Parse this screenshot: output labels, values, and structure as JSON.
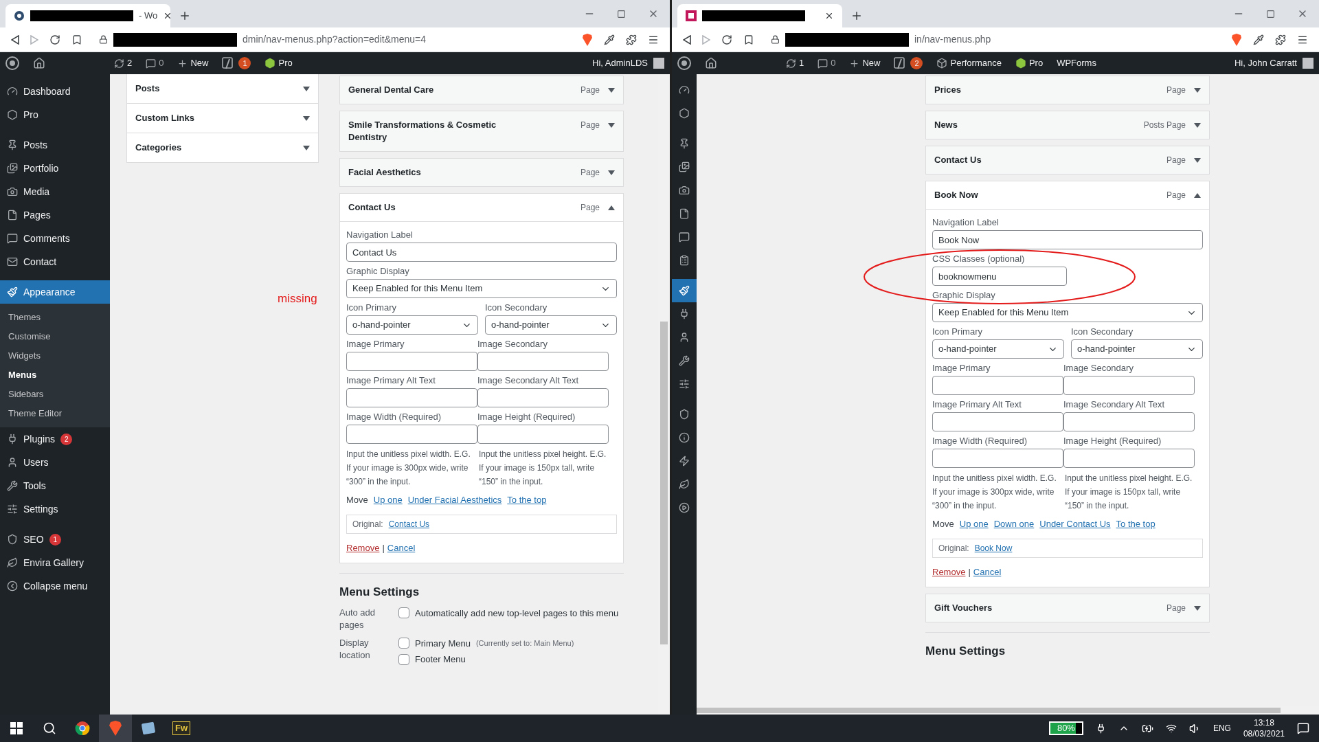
{
  "windows": [
    {
      "tab": {
        "title": "- Wo"
      },
      "url": "dmin/nav-menus.php?action=edit&menu=4",
      "admin_bar": {
        "updates": "2",
        "comments": "0",
        "new": "New",
        "badge": "1",
        "links": [
          {
            "kind": "pro",
            "label": "Pro"
          }
        ],
        "greeting": "Hi, AdminLDS"
      },
      "sidebar": {
        "kind": "full",
        "groups": [
          [
            {
              "label": "Dashboard",
              "selected": false
            },
            {
              "label": "Pro",
              "selected": false
            }
          ],
          [
            {
              "label": "Posts",
              "selected": false
            },
            {
              "label": "Portfolio",
              "selected": false
            },
            {
              "label": "Media",
              "selected": false
            },
            {
              "label": "Pages",
              "selected": false
            },
            {
              "label": "Comments",
              "selected": false
            },
            {
              "label": "Contact",
              "selected": false
            }
          ],
          [
            {
              "label": "Appearance",
              "selected": true,
              "children": [
                {
                  "label": "Themes",
                  "selected": false
                },
                {
                  "label": "Customise",
                  "selected": false
                },
                {
                  "label": "Widgets",
                  "selected": false
                },
                {
                  "label": "Menus",
                  "selected": true
                },
                {
                  "label": "Sidebars",
                  "selected": false
                },
                {
                  "label": "Theme Editor",
                  "selected": false
                }
              ]
            },
            {
              "label": "Plugins",
              "badge": "2",
              "selected": false
            },
            {
              "label": "Users",
              "selected": false
            },
            {
              "label": "Tools",
              "selected": false
            },
            {
              "label": "Settings",
              "selected": false
            }
          ],
          [
            {
              "label": "SEO",
              "badge": "1",
              "selected": false
            },
            {
              "label": "Envira Gallery",
              "selected": false
            },
            {
              "label": "Collapse menu",
              "selected": false
            }
          ]
        ]
      },
      "accordion": [
        {
          "title": "Posts",
          "expanded": false
        },
        {
          "title": "Custom Links",
          "expanded": false
        },
        {
          "title": "Categories",
          "expanded": false
        }
      ],
      "annotation": "missing",
      "menu_items": [
        {
          "title": "General Dental Care",
          "type": "Page",
          "expanded": false
        },
        {
          "title": "Smile Transformations & Cosmetic Dentistry",
          "type": "Page",
          "expanded": false
        },
        {
          "title": "Facial Aesthetics",
          "type": "Page",
          "expanded": false
        },
        {
          "title": "Contact Us",
          "type": "Page",
          "expanded": true,
          "settings": {
            "navigation_label": {
              "label": "Navigation Label",
              "value": "Contact Us"
            },
            "graphic_display": {
              "label": "Graphic Display",
              "value": "Keep Enabled for this Menu Item"
            },
            "icons": [
              {
                "label": "Icon Primary",
                "value": "o-hand-pointer"
              },
              {
                "label": "Icon Secondary",
                "value": "o-hand-pointer"
              }
            ],
            "image_fields": [
              [
                "Image Primary",
                "Image Secondary"
              ],
              [
                "Image Primary Alt Text",
                "Image Secondary Alt Text"
              ],
              [
                "Image Width (Required)",
                "Image Height (Required)"
              ]
            ],
            "help": [
              "Input the unitless pixel width. E.G. If your image is 300px wide, write “300” in the input.",
              "Input the unitless pixel height. E.G. If your image is 150px tall, write “150” in the input."
            ],
            "move": {
              "label": "Move",
              "links": [
                "Up one",
                "Under Facial Aesthetics",
                "To the top"
              ]
            },
            "original": {
              "label": "Original:",
              "link": "Contact Us"
            },
            "actions": {
              "remove": "Remove",
              "separator": "|",
              "cancel": "Cancel"
            }
          }
        }
      ],
      "menu_settings": {
        "title": "Menu Settings",
        "rows": [
          {
            "label": "Auto add pages",
            "options": [
              {
                "label": "Automatically add new top-level pages to this menu",
                "checked": false
              }
            ]
          },
          {
            "label": "Display location",
            "options": [
              {
                "label": "Primary Menu",
                "note": "(Currently set to: Main Menu)",
                "checked": false
              },
              {
                "label": "Footer Menu",
                "checked": false
              }
            ]
          }
        ]
      }
    },
    {
      "url": "in/nav-menus.php",
      "admin_bar": {
        "updates": "1",
        "comments": "0",
        "new": "New",
        "badge": "2",
        "links": [
          {
            "kind": "performance",
            "label": "Performance"
          },
          {
            "kind": "pro",
            "label": "Pro"
          },
          {
            "kind": "plain",
            "label": "WPForms"
          }
        ],
        "greeting": "Hi, John Carratt"
      },
      "sidebar": {
        "kind": "folded",
        "groups": [
          [
            {
              "selected": false
            },
            {
              "selected": false
            }
          ],
          [
            {
              "selected": false
            },
            {
              "selected": false
            },
            {
              "selected": false
            },
            {
              "selected": false
            },
            {
              "selected": false
            },
            {
              "selected": false
            }
          ],
          [
            {
              "selected": true
            },
            {
              "selected": false
            },
            {
              "selected": false
            },
            {
              "selected": false
            },
            {
              "selected": false
            }
          ],
          [
            {
              "selected": false
            },
            {
              "selected": false
            },
            {
              "selected": false
            },
            {
              "selected": false
            },
            {
              "selected": false
            }
          ]
        ]
      },
      "menu_items": [
        {
          "title": "Prices",
          "type": "Page",
          "expanded": false
        },
        {
          "title": "News",
          "type": "Posts Page",
          "expanded": false
        },
        {
          "title": "Contact Us",
          "type": "Page",
          "expanded": false
        },
        {
          "title": "Book Now",
          "type": "Page",
          "expanded": true,
          "settings": {
            "navigation_label": {
              "label": "Navigation Label",
              "value": "Book Now"
            },
            "css_classes": {
              "label": "CSS Classes (optional)",
              "value": "booknowmenu"
            },
            "graphic_display": {
              "label": "Graphic Display",
              "value": "Keep Enabled for this Menu Item"
            },
            "icons": [
              {
                "label": "Icon Primary",
                "value": "o-hand-pointer"
              },
              {
                "label": "Icon Secondary",
                "value": "o-hand-pointer"
              }
            ],
            "image_fields": [
              [
                "Image Primary",
                "Image Secondary"
              ],
              [
                "Image Primary Alt Text",
                "Image Secondary Alt Text"
              ],
              [
                "Image Width (Required)",
                "Image Height (Required)"
              ]
            ],
            "help": [
              "Input the unitless pixel width. E.G. If your image is 300px wide, write “300” in the input.",
              "Input the unitless pixel height. E.G. If your image is 150px tall, write “150” in the input."
            ],
            "move": {
              "label": "Move",
              "links": [
                "Up one",
                "Down one",
                "Under Contact Us",
                "To the top"
              ]
            },
            "original": {
              "label": "Original:",
              "link": "Book Now"
            },
            "actions": {
              "remove": "Remove",
              "separator": "|",
              "cancel": "Cancel"
            }
          }
        },
        {
          "title": "Gift Vouchers",
          "type": "Page",
          "expanded": false
        }
      ],
      "menu_settings": {
        "title": "Menu Settings"
      }
    }
  ],
  "taskbar": {
    "apps": [
      {
        "kind": "start",
        "selected": false
      },
      {
        "kind": "search",
        "selected": false
      },
      {
        "kind": "chrome",
        "selected": false
      },
      {
        "kind": "brave",
        "selected": true
      },
      {
        "kind": "tablet",
        "selected": false
      },
      {
        "kind": "fireworks",
        "label": "Fw",
        "selected": false
      }
    ],
    "battery": {
      "reading": "80%",
      "level": 0.8
    },
    "language": "ENG",
    "time": "13:18",
    "date": "08/03/2021"
  }
}
